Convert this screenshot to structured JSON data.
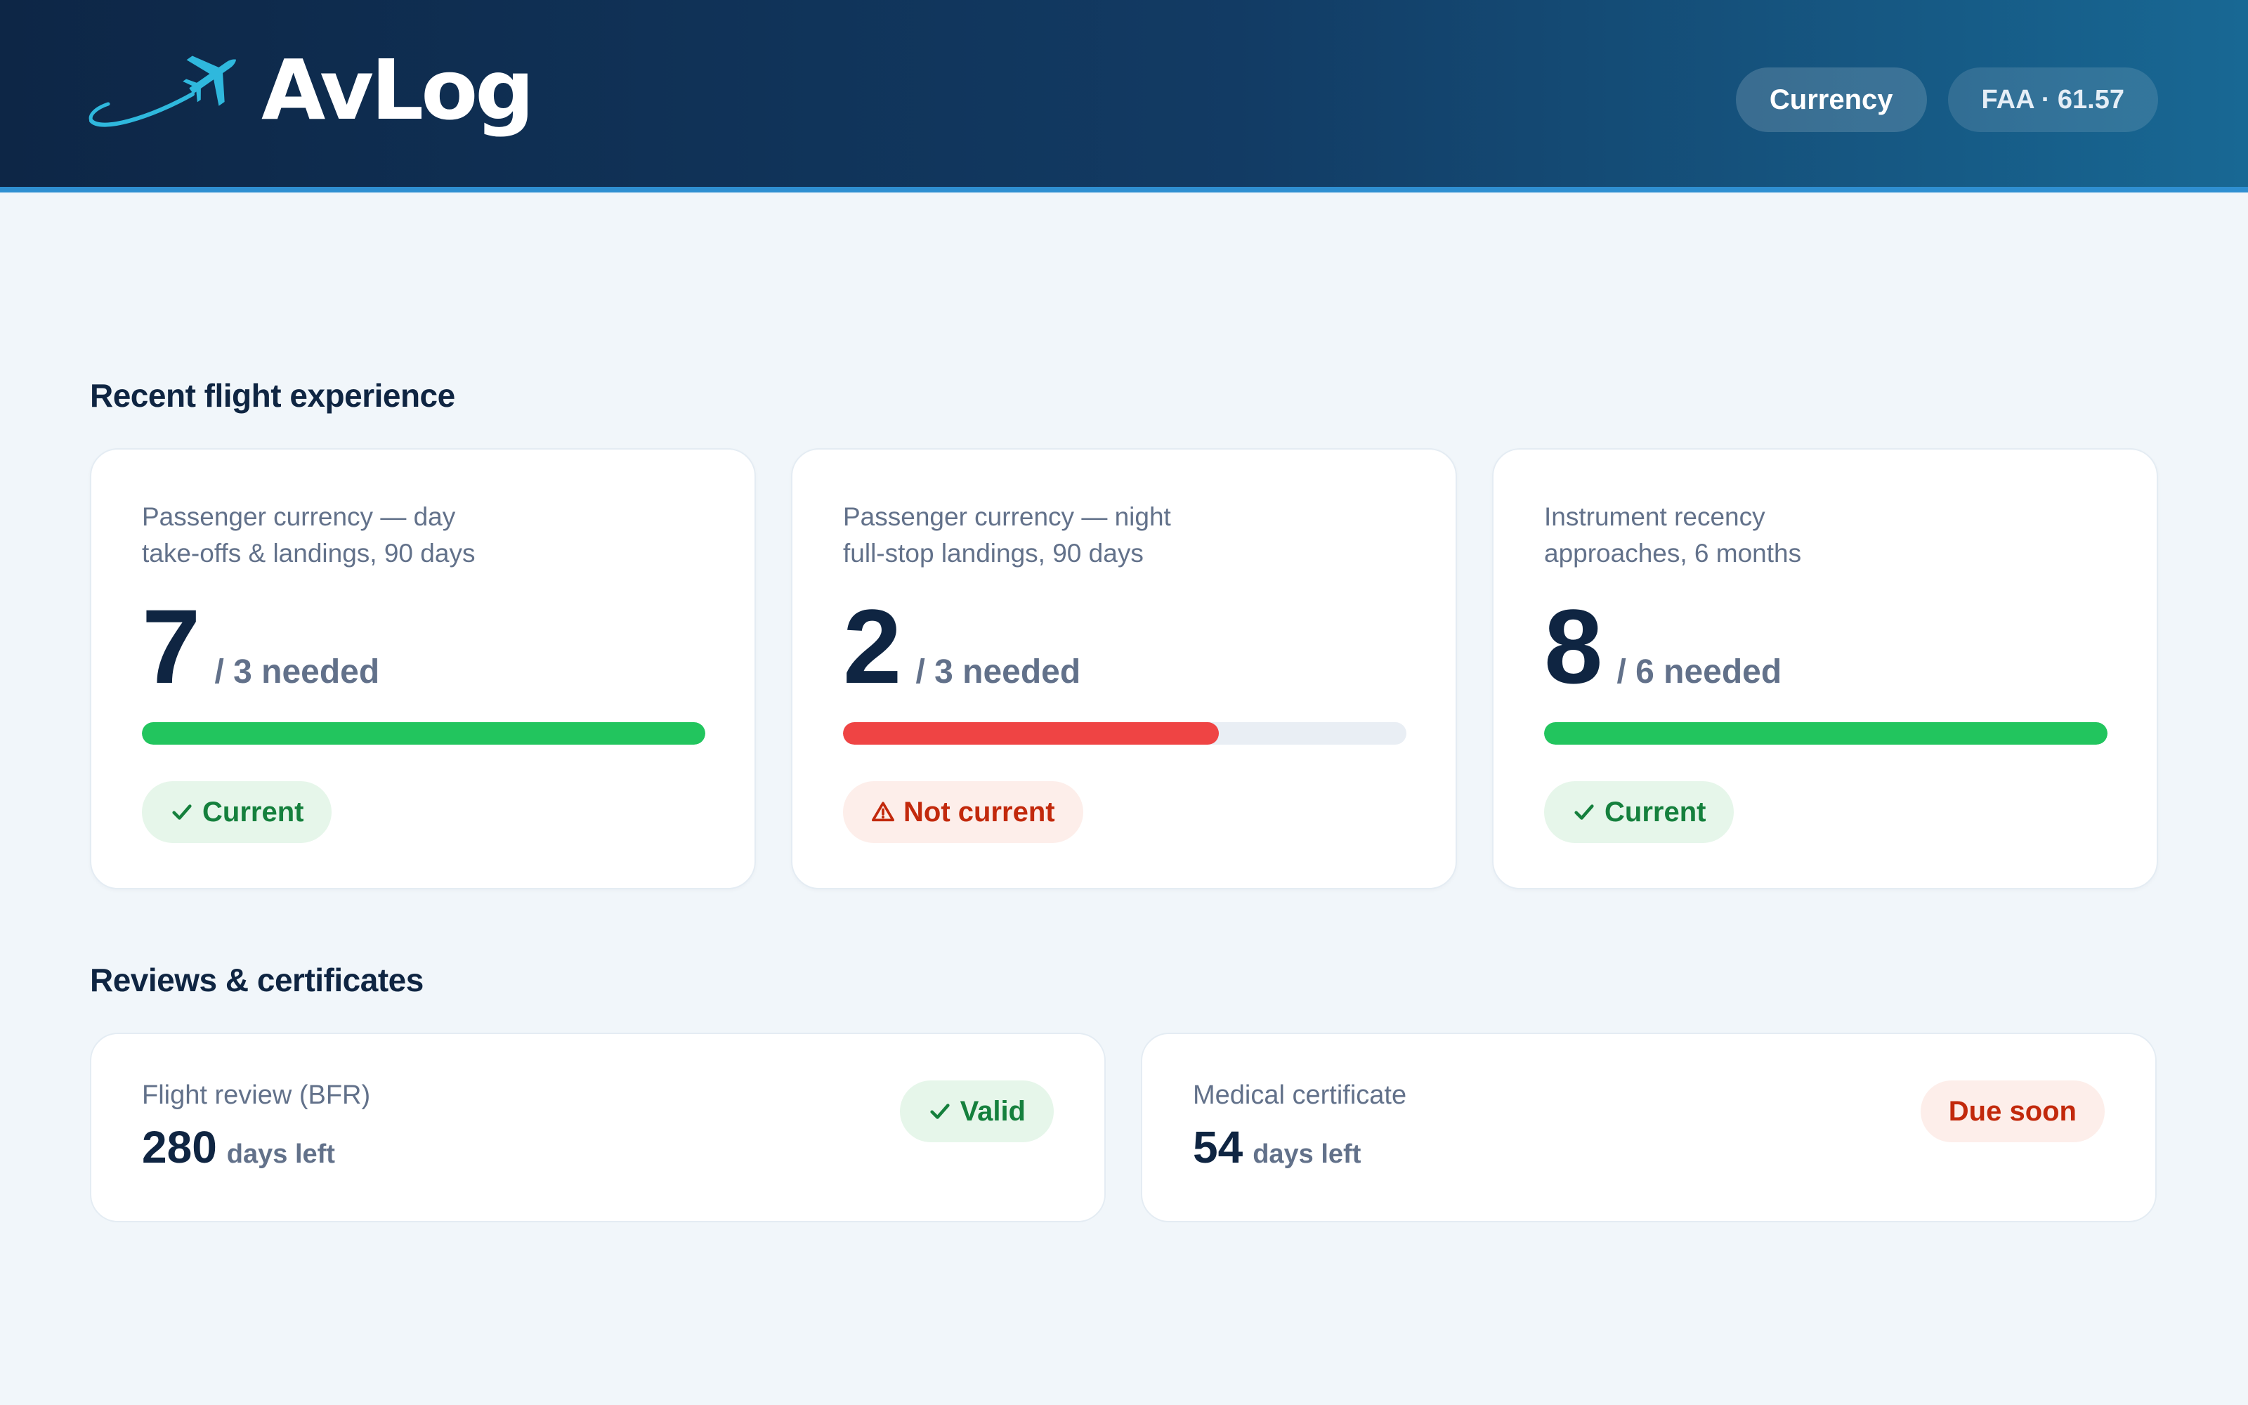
{
  "app": {
    "name": "AvLog"
  },
  "header": {
    "pills": [
      {
        "label": "Currency"
      },
      {
        "label": "FAA · 61.57"
      }
    ]
  },
  "sections": {
    "recent_title": "Recent flight experience",
    "reviews_title": "Reviews & certificates"
  },
  "currency_cards": [
    {
      "title_line1": "Passenger currency — day",
      "title_line2": "take-offs & landings, 90 days",
      "value": "7",
      "needed": "/ 3 needed",
      "progress": 1.0,
      "status": "Current",
      "status_type": "ok"
    },
    {
      "title_line1": "Passenger currency — night",
      "title_line2": "full-stop landings, 90 days",
      "value": "2",
      "needed": "/ 3 needed",
      "progress": 0.667,
      "status": "Not current",
      "status_type": "bad"
    },
    {
      "title_line1": "Instrument recency",
      "title_line2": "approaches, 6 months",
      "value": "8",
      "needed": "/ 6 needed",
      "progress": 1.0,
      "status": "Current",
      "status_type": "ok"
    }
  ],
  "review_cards": [
    {
      "label": "Flight review (BFR)",
      "days": "280",
      "unit": "days left",
      "status": "Valid",
      "status_type": "ok"
    },
    {
      "label": "Medical certificate",
      "days": "54",
      "unit": "days left",
      "status": "Due soon",
      "status_type": "bad"
    }
  ],
  "colors": {
    "ok_bar": "#22c55e",
    "bad_bar": "#ef4444",
    "navy": "#0f2542",
    "accent": "#2fb8dd"
  },
  "icons": {
    "logo": "airplane-icon",
    "ok": "checkmark-icon",
    "bad": "warning-triangle-icon"
  }
}
